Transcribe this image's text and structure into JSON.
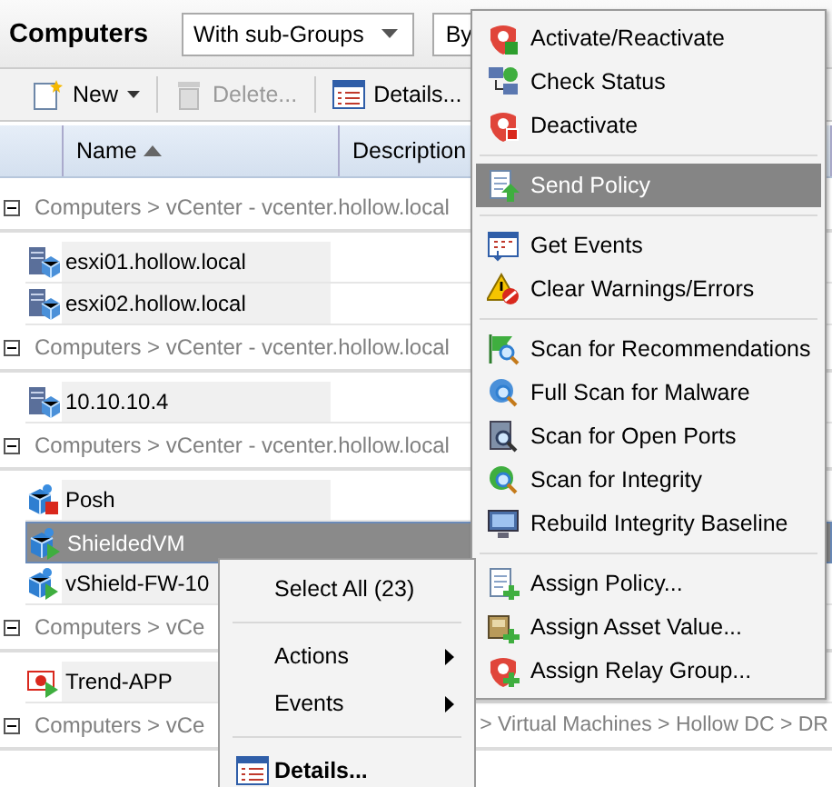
{
  "header": {
    "title": "Computers",
    "filters": [
      {
        "value": "With sub-Groups"
      },
      {
        "value": "By"
      }
    ]
  },
  "toolbar": [
    {
      "label": "New",
      "kind": "new",
      "disabled": false,
      "dropdown": true
    },
    {
      "label": "Delete...",
      "kind": "delete",
      "disabled": true,
      "dropdown": false
    },
    {
      "label": "Details...",
      "kind": "details",
      "disabled": false,
      "dropdown": false
    }
  ],
  "columns": [
    {
      "label": "Name",
      "sorted": true
    },
    {
      "label": "Description"
    }
  ],
  "groups": [
    {
      "path": [
        "Computers > vCenter - vcenter.hollow.local"
      ],
      "rows": [
        {
          "name": "esxi01.hollow.local",
          "kind": "host",
          "selected": false
        },
        {
          "name": "esxi02.hollow.local",
          "kind": "host",
          "selected": false
        }
      ]
    },
    {
      "path": [
        "Computers > vCenter - vcenter.hollow.local"
      ],
      "rows": [
        {
          "name": "10.10.10.4",
          "kind": "host",
          "selected": false
        }
      ]
    },
    {
      "path": [
        "Computers > vCenter - vcenter.hollow.local"
      ],
      "rows": [
        {
          "name": "Posh",
          "kind": "vm-stopped",
          "selected": false
        },
        {
          "name": "ShieldedVM",
          "kind": "vm",
          "selected": true
        },
        {
          "name": "vShield-FW-10",
          "kind": "vm",
          "selected": false
        }
      ]
    },
    {
      "path": [
        "Computers > vCe"
      ],
      "rows": [
        {
          "name": "Trend-APP",
          "kind": "appliance",
          "selected": false
        }
      ]
    },
    {
      "path": [
        "Computers > vCe",
        "> Virtual Machines > Hollow DC > DR"
      ]
    }
  ],
  "actions_menu": [
    {
      "kind": "item",
      "label": "Activate/Reactivate",
      "selected": false
    },
    {
      "kind": "item",
      "label": "Check Status",
      "selected": false
    },
    {
      "kind": "item",
      "label": "Deactivate",
      "selected": false
    },
    {
      "kind": "separator"
    },
    {
      "kind": "item",
      "label": "Send Policy",
      "selected": true
    },
    {
      "kind": "separator"
    },
    {
      "kind": "item",
      "label": "Get Events",
      "selected": false
    },
    {
      "kind": "item",
      "label": "Clear Warnings/Errors",
      "selected": false
    },
    {
      "kind": "separator"
    },
    {
      "kind": "item",
      "label": "Scan for Recommendations",
      "selected": false
    },
    {
      "kind": "item",
      "label": "Full Scan for Malware",
      "selected": false
    },
    {
      "kind": "item",
      "label": "Scan for Open Ports",
      "selected": false
    },
    {
      "kind": "item",
      "label": "Scan for Integrity",
      "selected": false
    },
    {
      "kind": "item",
      "label": "Rebuild Integrity Baseline",
      "selected": false
    },
    {
      "kind": "separator"
    },
    {
      "kind": "item",
      "label": "Assign Policy...",
      "selected": false
    },
    {
      "kind": "item",
      "label": "Assign Asset Value...",
      "selected": false
    },
    {
      "kind": "item",
      "label": "Assign Relay Group...",
      "selected": false
    }
  ],
  "context_menu": [
    {
      "kind": "item",
      "label": "Select All (23)",
      "submenu": false,
      "bold": false
    },
    {
      "kind": "separator"
    },
    {
      "kind": "item",
      "label": "Actions",
      "submenu": true,
      "bold": false
    },
    {
      "kind": "item",
      "label": "Events",
      "submenu": true,
      "bold": false
    },
    {
      "kind": "separator"
    },
    {
      "kind": "icon-item",
      "label": "Details...",
      "submenu": false,
      "bold": true
    }
  ]
}
